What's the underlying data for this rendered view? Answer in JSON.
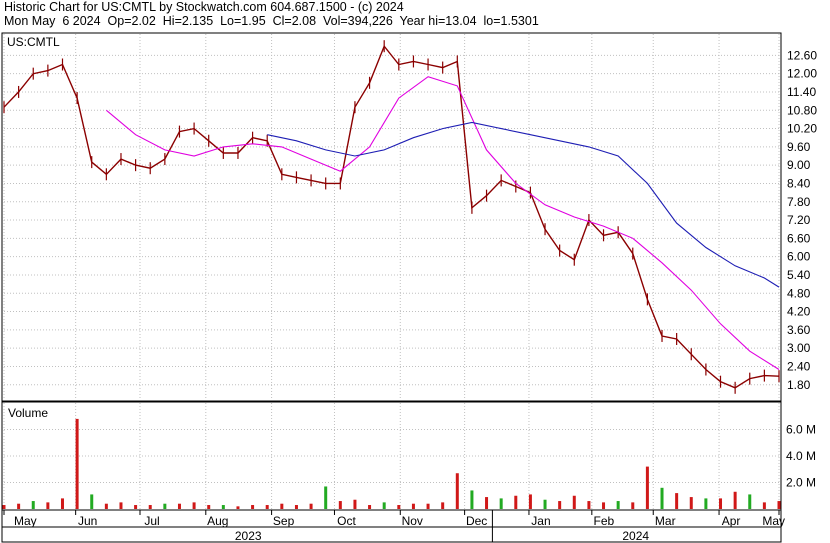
{
  "header": {
    "line1": "Historic Chart for US:CMTL by Stockwatch.com 604.687.1500 - (c) 2024",
    "line2": "Mon May  6 2024  Op=2.02  Hi=2.135  Lo=1.95  Cl=2.08  Vol=394,226  Year hi=13.04  lo=1.5301"
  },
  "colors": {
    "price": "#8b0000",
    "ma_short": "#e000e0",
    "ma_long": "#1e1eb4",
    "volume_normal": "#d01818",
    "volume_up": "#22aa22",
    "grid": "#c0c0c0"
  },
  "chart_data": [
    {
      "type": "line",
      "title": "US:CMTL",
      "y_ticks": [
        "12.60",
        "12.00",
        "11.40",
        "10.80",
        "10.20",
        "9.60",
        "9.00",
        "8.40",
        "7.80",
        "7.20",
        "6.60",
        "6.00",
        "5.40",
        "4.80",
        "4.20",
        "3.60",
        "3.00",
        "2.40",
        "1.80"
      ],
      "ylim": [
        1.3,
        13.3
      ],
      "x_domain": [
        0,
        53
      ],
      "grid": true,
      "series": [
        {
          "role": "price",
          "x": [
            0,
            1,
            2,
            3,
            4,
            5,
            6,
            7,
            8,
            9,
            10,
            11,
            12,
            13,
            14,
            15,
            16,
            17,
            18,
            19,
            20,
            21,
            22,
            23,
            24,
            25,
            26,
            27,
            28,
            29,
            30,
            31,
            32,
            33,
            34,
            35,
            36,
            37,
            38,
            39,
            40,
            41,
            42,
            43,
            44,
            45,
            46,
            47,
            48,
            49,
            50,
            51,
            52,
            53
          ],
          "values": [
            10.9,
            11.4,
            12.0,
            12.1,
            12.3,
            11.2,
            9.1,
            8.7,
            9.2,
            9.0,
            8.9,
            9.2,
            10.1,
            10.2,
            9.8,
            9.4,
            9.4,
            9.9,
            9.8,
            8.7,
            8.6,
            8.5,
            8.4,
            8.4,
            10.9,
            11.7,
            12.9,
            12.3,
            12.4,
            12.3,
            12.2,
            12.4,
            7.6,
            8.0,
            8.5,
            8.3,
            8.1,
            6.9,
            6.2,
            5.9,
            7.2,
            6.7,
            6.8,
            6.1,
            4.6,
            3.4,
            3.3,
            2.8,
            2.3,
            1.9,
            1.7,
            2.0,
            2.1,
            2.08
          ]
        },
        {
          "role": "ma_short",
          "x": [
            7,
            9,
            11,
            13,
            15,
            17,
            19,
            21,
            23,
            25,
            27,
            29,
            31,
            33,
            35,
            37,
            39,
            41,
            43,
            45,
            47,
            49,
            51,
            53
          ],
          "values": [
            10.8,
            10.0,
            9.5,
            9.3,
            9.6,
            9.7,
            9.6,
            9.2,
            8.8,
            9.6,
            11.2,
            11.9,
            11.6,
            9.5,
            8.4,
            7.7,
            7.3,
            7.0,
            6.6,
            5.8,
            4.9,
            3.8,
            2.9,
            2.3
          ]
        },
        {
          "role": "ma_long",
          "x": [
            18,
            20,
            22,
            24,
            26,
            28,
            30,
            32,
            34,
            36,
            38,
            40,
            42,
            44,
            46,
            48,
            50,
            52,
            53
          ],
          "values": [
            10.0,
            9.8,
            9.5,
            9.3,
            9.5,
            9.9,
            10.2,
            10.4,
            10.2,
            10.0,
            9.8,
            9.6,
            9.3,
            8.4,
            7.1,
            6.3,
            5.7,
            5.3,
            5.0
          ]
        }
      ]
    },
    {
      "type": "bar",
      "title": "Volume",
      "y_ticks": [
        "6.0 M",
        "4.0 M",
        "2.0 M"
      ],
      "y_tick_values": [
        6.0,
        4.0,
        2.0
      ],
      "ylim": [
        0,
        8.0
      ],
      "x_domain": [
        0,
        53
      ],
      "x": [
        0,
        1,
        2,
        3,
        4,
        5,
        6,
        7,
        8,
        9,
        10,
        11,
        12,
        13,
        14,
        15,
        16,
        17,
        18,
        19,
        20,
        21,
        22,
        23,
        24,
        25,
        26,
        27,
        28,
        29,
        30,
        31,
        32,
        33,
        34,
        35,
        36,
        37,
        38,
        39,
        40,
        41,
        42,
        43,
        44,
        45,
        46,
        47,
        48,
        49,
        50,
        51,
        52,
        53
      ],
      "values": [
        0.3,
        0.4,
        0.6,
        0.5,
        0.8,
        6.8,
        1.1,
        0.4,
        0.5,
        0.3,
        0.3,
        0.4,
        0.4,
        0.5,
        0.3,
        0.3,
        0.2,
        0.3,
        0.3,
        0.4,
        0.3,
        0.4,
        1.7,
        0.6,
        0.7,
        0.3,
        0.5,
        0.3,
        0.4,
        0.4,
        0.5,
        2.7,
        1.4,
        0.9,
        0.8,
        1.0,
        1.1,
        0.7,
        0.6,
        1.0,
        0.6,
        0.5,
        0.6,
        0.5,
        3.2,
        1.6,
        1.2,
        0.9,
        0.8,
        0.8,
        1.3,
        1.1,
        0.5,
        0.6
      ],
      "up": [
        false,
        false,
        true,
        false,
        false,
        false,
        true,
        false,
        false,
        false,
        false,
        true,
        false,
        false,
        false,
        true,
        false,
        false,
        false,
        false,
        false,
        false,
        true,
        false,
        false,
        false,
        true,
        false,
        false,
        false,
        false,
        false,
        true,
        false,
        true,
        false,
        false,
        true,
        false,
        false,
        false,
        false,
        true,
        false,
        false,
        true,
        false,
        false,
        true,
        false,
        false,
        true,
        false,
        false
      ],
      "x_ticks": [
        "May",
        "Jun",
        "Jul",
        "Aug",
        "Sep",
        "Oct",
        "Nov",
        "Dec",
        "Jan",
        "Feb",
        "Mar",
        "Apr",
        "May"
      ],
      "x_tick_positions": [
        0,
        4.9,
        9.3,
        13.8,
        18.3,
        22.6,
        27.1,
        31.5,
        35.9,
        40.2,
        44.4,
        48.9,
        53
      ],
      "year_labels": [
        "2023",
        "2024"
      ],
      "year_spans": [
        [
          0,
          33.4
        ],
        [
          33.4,
          53
        ]
      ]
    }
  ]
}
